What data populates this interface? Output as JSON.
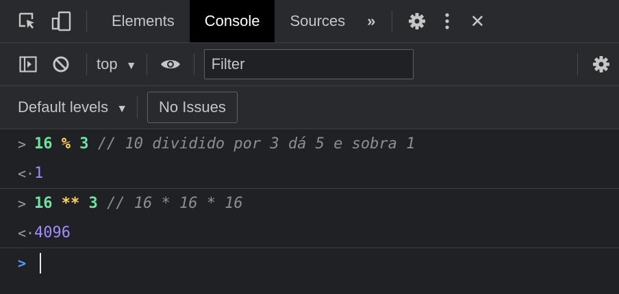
{
  "tabs": {
    "items": [
      {
        "label": "Elements",
        "active": false
      },
      {
        "label": "Console",
        "active": true
      },
      {
        "label": "Sources",
        "active": false
      }
    ],
    "more": "»",
    "close": "✕"
  },
  "toolbar": {
    "context": "top",
    "filter_placeholder": "Filter"
  },
  "levels": {
    "label": "Default levels",
    "issues": "No Issues"
  },
  "console": {
    "entries": [
      {
        "left": "16",
        "op": "%",
        "right": "3",
        "comment": "// 10 dividido por 3 dá 5 e sobra 1",
        "result": "1"
      },
      {
        "left": "16",
        "op": "**",
        "right": "3",
        "comment": "// 16 * 16 * 16",
        "result": "4096"
      }
    ]
  },
  "colors": {
    "background": "#202124",
    "toolbar": "#292a2d",
    "active_tab": "#000000",
    "number": "#6fe3a0",
    "operator": "#ffd65c",
    "comment": "#8b8e93",
    "result": "#a48bff",
    "prompt_active": "#4e9cff"
  }
}
